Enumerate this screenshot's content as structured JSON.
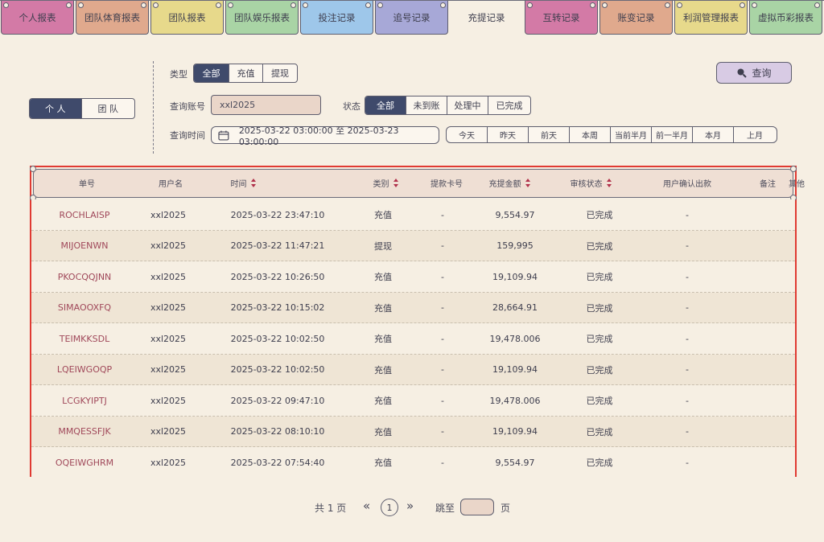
{
  "tabs": [
    {
      "label": "个人报表",
      "color": "#d37aa6"
    },
    {
      "label": "团队体育报表",
      "color": "#e0a98d"
    },
    {
      "label": "团队报表",
      "color": "#e7d98b"
    },
    {
      "label": "团队娱乐报表",
      "color": "#a9d4a5"
    },
    {
      "label": "投注记录",
      "color": "#9ec7ea"
    },
    {
      "label": "追号记录",
      "color": "#a7a8d7"
    },
    {
      "label": "充提记录",
      "color": "#f6efe3",
      "active": true
    },
    {
      "label": "互转记录",
      "color": "#d37aa6"
    },
    {
      "label": "账变记录",
      "color": "#e0a98d"
    },
    {
      "label": "利润管理报表",
      "color": "#e7d98b"
    },
    {
      "label": "虚拟币彩报表",
      "color": "#a9d4a5"
    }
  ],
  "scope": {
    "options": [
      "个 人",
      "团 队"
    ],
    "selected": 0
  },
  "filters": {
    "type_label": "类型",
    "type_options": [
      "全部",
      "充值",
      "提现"
    ],
    "type_selected": 0,
    "account_label": "查询账号",
    "account_value": "xxl2025",
    "status_label": "状态",
    "status_options": [
      "全部",
      "未到账",
      "处理中",
      "已完成"
    ],
    "status_selected": 0,
    "time_label": "查询时间",
    "time_range": "2025-03-22 03:00:00 至 2025-03-23 03:00:00",
    "quick_ranges": [
      "今天",
      "昨天",
      "前天",
      "本周",
      "当前半月",
      "前一半月",
      "本月",
      "上月"
    ],
    "query_label": "查询"
  },
  "table": {
    "headers": [
      "单号",
      "用户名",
      "时间",
      "类别",
      "提款卡号",
      "充提金额",
      "审核状态",
      "用户确认出款",
      "备注",
      "其他"
    ],
    "rows": [
      [
        "ROCHLAISP",
        "xxl2025",
        "2025-03-22 23:47:10",
        "充值",
        "-",
        "9,554.97",
        "已完成",
        "-"
      ],
      [
        "MIJOENWN",
        "xxl2025",
        "2025-03-22 11:47:21",
        "提现",
        "-",
        "159,995",
        "已完成",
        "-"
      ],
      [
        "PKOCQQJNN",
        "xxl2025",
        "2025-03-22 10:26:50",
        "充值",
        "-",
        "19,109.94",
        "已完成",
        "-"
      ],
      [
        "SIMAOOXFQ",
        "xxl2025",
        "2025-03-22 10:15:02",
        "充值",
        "-",
        "28,664.91",
        "已完成",
        "-"
      ],
      [
        "TEIMKKSDL",
        "xxl2025",
        "2025-03-22 10:02:50",
        "充值",
        "-",
        "19,478.006",
        "已完成",
        "-"
      ],
      [
        "LQEIWGOQP",
        "xxl2025",
        "2025-03-22 10:02:50",
        "充值",
        "-",
        "19,109.94",
        "已完成",
        "-"
      ],
      [
        "LCGKYIPTJ",
        "xxl2025",
        "2025-03-22 09:47:10",
        "充值",
        "-",
        "19,478.006",
        "已完成",
        "-"
      ],
      [
        "MMQESSFJK",
        "xxl2025",
        "2025-03-22 08:10:10",
        "充值",
        "-",
        "19,109.94",
        "已完成",
        "-"
      ],
      [
        "OQEIWGHRM",
        "xxl2025",
        "2025-03-22 07:54:40",
        "充值",
        "-",
        "9,554.97",
        "已完成",
        "-"
      ]
    ]
  },
  "pager": {
    "total_text": "共 1 页",
    "prev": "«",
    "current": "1",
    "next": "»",
    "jump_label": "跳至",
    "page_suffix": "页"
  },
  "colors": {
    "accent": "#3f4a6b",
    "highlight_border": "#e03a32",
    "query_button": "#d8cbe4"
  }
}
